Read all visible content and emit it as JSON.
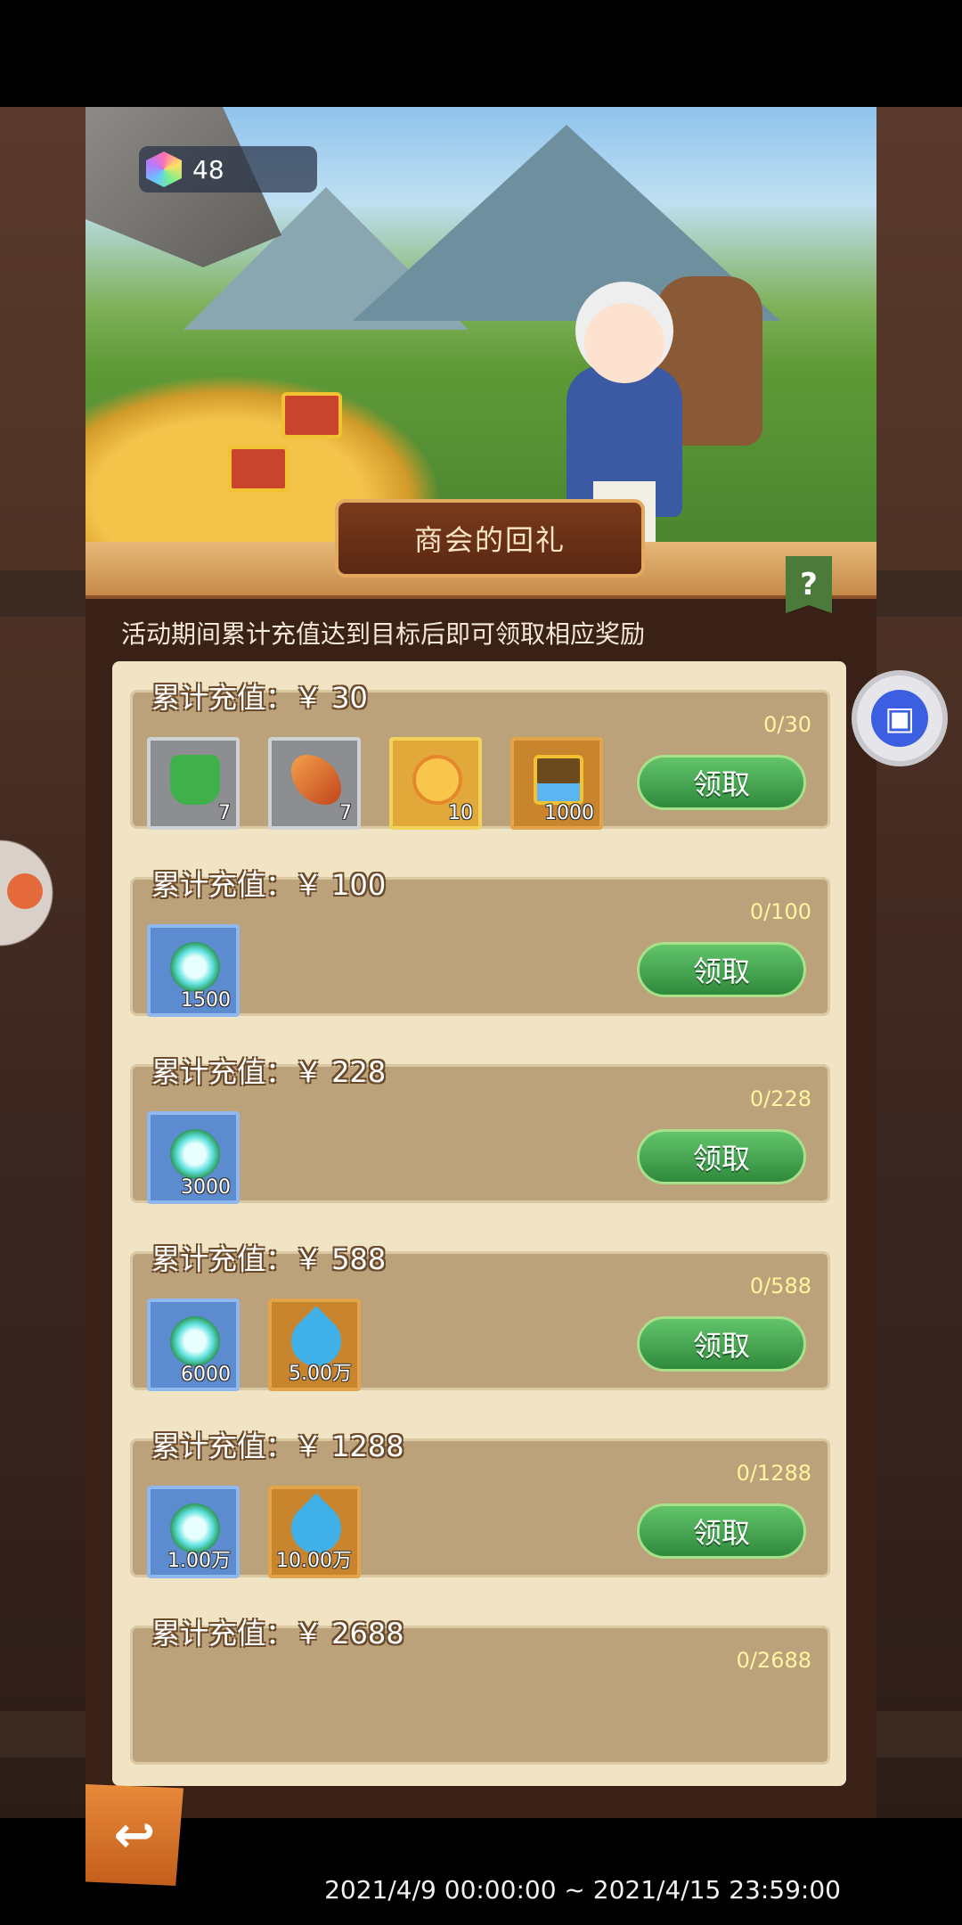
{
  "currency": {
    "gems": "48",
    "icon": "rainbow-gem-icon"
  },
  "event": {
    "title": "商会的回礼",
    "description": "活动期间累计充值达到目标后即可领取相应奖励",
    "help_label": "?",
    "date_range": "2021/4/9 00:00:00 ~ 2021/4/15 23:59:00"
  },
  "claim_label": "领取",
  "tiers": [
    {
      "label": "累计充值：￥ 30",
      "progress": "0/30",
      "items": [
        {
          "icon": "green-potion-icon",
          "qty": "7"
        },
        {
          "icon": "orange-scroll-icon",
          "qty": "7"
        },
        {
          "icon": "gold-coin-icon",
          "qty": "10"
        },
        {
          "icon": "gem-chest-icon",
          "qty": "1000"
        }
      ]
    },
    {
      "label": "累计充值：￥ 100",
      "progress": "0/100",
      "items": [
        {
          "icon": "spirit-flower-icon",
          "qty": "1500"
        }
      ]
    },
    {
      "label": "累计充值：￥ 228",
      "progress": "0/228",
      "items": [
        {
          "icon": "spirit-flower-icon",
          "qty": "3000"
        }
      ]
    },
    {
      "label": "累计充值：￥ 588",
      "progress": "0/588",
      "items": [
        {
          "icon": "spirit-flower-icon",
          "qty": "6000"
        },
        {
          "icon": "water-drop-icon",
          "qty": "5.00万"
        }
      ]
    },
    {
      "label": "累计充值：￥ 1288",
      "progress": "0/1288",
      "items": [
        {
          "icon": "spirit-flower-icon",
          "qty": "1.00万"
        },
        {
          "icon": "water-drop-icon",
          "qty": "10.00万"
        }
      ]
    },
    {
      "label": "累计充值：￥ 2688",
      "progress": "0/2688",
      "items": []
    }
  ]
}
